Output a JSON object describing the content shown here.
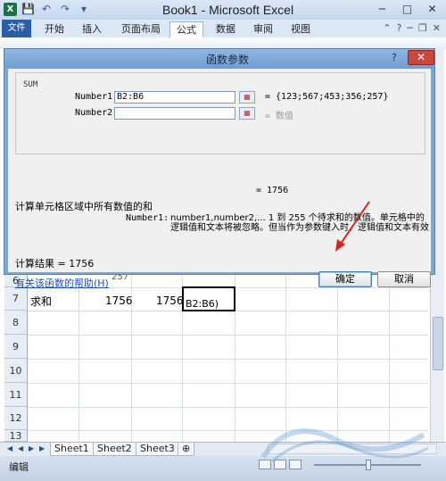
{
  "window": {
    "title": "Book1 - Microsoft Excel",
    "min": "─",
    "max": "□",
    "close": "✕"
  },
  "qat": {
    "save": "💾",
    "undo": "↶",
    "redo": "↷",
    "more": "▾"
  },
  "ribbon": {
    "file_tab": "文件",
    "tabs": [
      "开始",
      "插入",
      "页面布局",
      "公式",
      "数据",
      "审阅",
      "视图"
    ],
    "active_tab": "公式"
  },
  "sheet": {
    "rows": [
      {
        "header": "6",
        "cells": [
          "",
          "",
          "",
          ""
        ]
      },
      {
        "header": "7",
        "cells": [
          "求和",
          "1756",
          "1756",
          "B2:B6)"
        ]
      },
      {
        "header": "8",
        "cells": [
          "",
          "",
          "",
          ""
        ]
      },
      {
        "header": "9",
        "cells": [
          "",
          "",
          "",
          ""
        ]
      },
      {
        "header": "10",
        "cells": [
          "",
          "",
          "",
          ""
        ]
      },
      {
        "header": "11",
        "cells": [
          "",
          "",
          "",
          ""
        ]
      },
      {
        "header": "12",
        "cells": [
          "",
          "",
          "",
          ""
        ]
      },
      {
        "header": "13",
        "cells": [
          "",
          "",
          "",
          ""
        ]
      }
    ],
    "partial_above": "257"
  },
  "sheet_tabs": [
    "Sheet1",
    "Sheet2",
    "Sheet3"
  ],
  "status": {
    "mode": "编辑"
  },
  "dialog": {
    "title": "函数参数",
    "help_icon": "?",
    "close": "✕",
    "function_name": "SUM",
    "args": [
      {
        "label": "Number1",
        "value": "B2:B6",
        "result": "= {123;567;453;356;257}"
      },
      {
        "label": "Number2",
        "value": "",
        "result": "= 数值"
      }
    ],
    "sum_result": "= 1756",
    "description": "计算单元格区域中所有数值的和",
    "arg_description_label": "Number1:",
    "arg_description": "number1,number2,... 1 到 255 个待求和的数值。单元格中的逻辑值和文本将被忽略。但当作为参数键入时，逻辑值和文本有效",
    "calc_result": "计算结果 = 1756",
    "help_link": "有关该函数的帮助(H)",
    "ok_label": "确定",
    "cancel_label": "取消"
  }
}
